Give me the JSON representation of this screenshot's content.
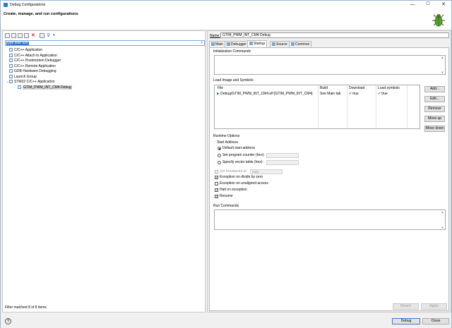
{
  "window": {
    "title": "Debug Configurations",
    "minimize": "—",
    "maximize": "☐",
    "close": "✕"
  },
  "header": {
    "title": "Create, manage, and run configurations"
  },
  "left": {
    "filter_value": "type filter text",
    "clear_glyph": "×",
    "tree": [
      {
        "label": "C/C++ Application",
        "indent": 0,
        "twisty": ""
      },
      {
        "label": "C/C++ Attach to Application",
        "indent": 0,
        "twisty": ""
      },
      {
        "label": "C/C++ Postmortem Debugger",
        "indent": 0,
        "twisty": ""
      },
      {
        "label": "C/C++ Remote Application",
        "indent": 0,
        "twisty": ""
      },
      {
        "label": "GDB Hardware Debugging",
        "indent": 0,
        "twisty": ""
      },
      {
        "label": "Launch Group",
        "indent": 0,
        "twisty": ""
      },
      {
        "label": "STM32 C/C++ Application",
        "indent": 0,
        "twisty": "⌄"
      },
      {
        "label": "GTIM_PWM_INT_CM4 Debug",
        "indent": 1,
        "twisty": "",
        "selected": true
      }
    ],
    "footer": "Filter matched 8 of 8 items"
  },
  "right": {
    "name_label": "Name:",
    "name_value": "GTIM_PWM_INT_CM4 Debug",
    "tabs": [
      {
        "label": "Main",
        "active": false
      },
      {
        "label": "Debugger",
        "active": false
      },
      {
        "label": "Startup",
        "active": true
      },
      {
        "label": "Source",
        "active": false
      },
      {
        "label": "Common",
        "active": false
      }
    ],
    "init_commands": {
      "label": "Initialization Commands"
    },
    "load_image": {
      "label": "Load Image and Symbols",
      "columns": [
        "File",
        "Build",
        "Download",
        "Load symbols"
      ],
      "rows": [
        {
          "file": "Debug/GTIM_PWM_INT_CM4.elf [GTIM_PWM_INT_CM4]",
          "build": "See Main tab",
          "download": "true",
          "load_symbols": "true"
        }
      ],
      "buttons": [
        "Add...",
        "Edit...",
        "Remove",
        "Move up",
        "Move down"
      ]
    },
    "runtime": {
      "label": "Runtime Options",
      "start_address_label": "Start Address",
      "radios": [
        "Default start address",
        "Set program counter (hex):",
        "Specify vector table (hex):"
      ],
      "breakpoint_label": "Set breakpoint at:",
      "breakpoint_value": "main",
      "checks": [
        {
          "label": "Exception on divide by zero",
          "checked": true
        },
        {
          "label": "Exception on unaligned access",
          "checked": false
        },
        {
          "label": "Halt on exception",
          "checked": true
        },
        {
          "label": "Resume",
          "checked": true
        }
      ]
    },
    "run_commands": {
      "label": "Run Commands"
    },
    "revert": "Revert",
    "apply": "Apply"
  },
  "footer": {
    "help": "?",
    "debug": "Debug",
    "close": "Close"
  },
  "colors": {
    "accent": "#3074d0",
    "check": "#2a9a2a"
  }
}
